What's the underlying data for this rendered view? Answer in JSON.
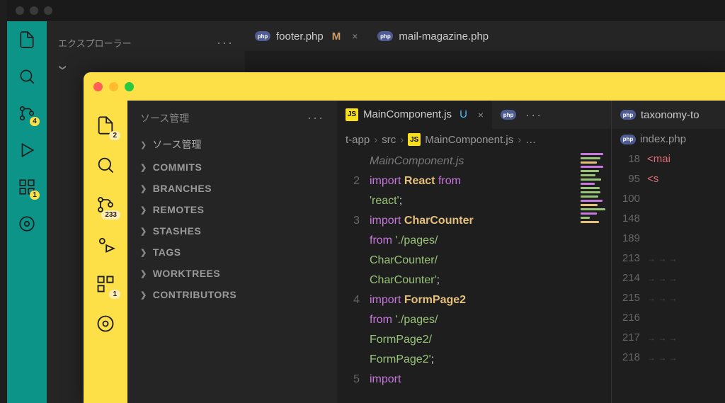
{
  "back": {
    "explorer_title": "エクスプローラー",
    "tabs": [
      {
        "icon": "php",
        "name": "footer.php",
        "status": "M",
        "closable": true
      },
      {
        "icon": "php",
        "name": "mail-magazine.php",
        "status": "",
        "closable": false
      }
    ],
    "activity_badges": {
      "scm": "4",
      "ext": "1"
    }
  },
  "front": {
    "scm_title": "ソース管理",
    "activity_badges": {
      "files": "2",
      "scm": "233",
      "ext": "1"
    },
    "sidebar_items": [
      {
        "label": "ソース管理"
      },
      {
        "label": "COMMITS"
      },
      {
        "label": "BRANCHES"
      },
      {
        "label": "REMOTES"
      },
      {
        "label": "STASHES"
      },
      {
        "label": "TAGS"
      },
      {
        "label": "WORKTREES"
      },
      {
        "label": "CONTRIBUTORS"
      }
    ],
    "main_editor": {
      "tab": {
        "icon": "js",
        "name": "MainComponent.js",
        "status": "U"
      },
      "extra_tab_icon": "php",
      "breadcrumbs": [
        "t-app",
        "src",
        "MainComponent.js",
        "…"
      ],
      "bc_icon": "js",
      "gutter_start_blank": true,
      "lines": [
        {
          "num": "",
          "html": "MainComponent.js",
          "cls": "tk-cmt"
        },
        {
          "num": "2",
          "tokens": [
            [
              "kw",
              "import "
            ],
            [
              "cls",
              "React "
            ],
            [
              "kw",
              "from"
            ]
          ]
        },
        {
          "num": "",
          "tokens": [
            [
              "str",
              "'react'"
            ],
            [
              "pl",
              ";"
            ]
          ]
        },
        {
          "num": "3",
          "tokens": [
            [
              "kw",
              "import "
            ],
            [
              "cls",
              "CharCounter"
            ]
          ]
        },
        {
          "num": "",
          "tokens": [
            [
              "kw",
              "from "
            ],
            [
              "str",
              "'./pages/"
            ]
          ]
        },
        {
          "num": "",
          "tokens": [
            [
              "str",
              "CharCounter/"
            ]
          ]
        },
        {
          "num": "",
          "tokens": [
            [
              "str",
              "CharCounter'"
            ],
            [
              "pl",
              ";"
            ]
          ]
        },
        {
          "num": "4",
          "tokens": [
            [
              "kw",
              "import "
            ],
            [
              "cls",
              "FormPage2"
            ]
          ]
        },
        {
          "num": "",
          "tokens": [
            [
              "kw",
              "from "
            ],
            [
              "str",
              "'./pages/"
            ]
          ]
        },
        {
          "num": "",
          "tokens": [
            [
              "str",
              "FormPage2/"
            ]
          ]
        },
        {
          "num": "",
          "tokens": [
            [
              "str",
              "FormPage2'"
            ],
            [
              "pl",
              ";"
            ]
          ]
        },
        {
          "num": "5",
          "tokens": [
            [
              "kw",
              "import"
            ]
          ]
        }
      ],
      "minimap_colors": [
        "#c678dd",
        "#98c379",
        "#e5c07b",
        "#c678dd",
        "#98c379",
        "#98c379",
        "#98c379",
        "#c678dd",
        "#98c379",
        "#98c379",
        "#98c379",
        "#c678dd",
        "#e5c07b",
        "#98c379",
        "#c678dd",
        "#98c379",
        "#e5c07b"
      ]
    },
    "side_editor": {
      "tab": {
        "icon": "php",
        "name": "taxonomy-to"
      },
      "crumb": {
        "icon": "php",
        "name": "index.php"
      },
      "lines": [
        {
          "num": "18",
          "txt": "<mai",
          "tag": true
        },
        {
          "num": "95",
          "txt": "<s",
          "tag": true
        },
        {
          "num": "100",
          "txt": ""
        },
        {
          "num": "148",
          "txt": ""
        },
        {
          "num": "189",
          "txt": ""
        },
        {
          "num": "213",
          "ws": true
        },
        {
          "num": "214",
          "ws": true
        },
        {
          "num": "215",
          "ws": true
        },
        {
          "num": "216",
          "txt": ""
        },
        {
          "num": "217",
          "ws": true
        },
        {
          "num": "218",
          "ws": true
        }
      ]
    }
  }
}
